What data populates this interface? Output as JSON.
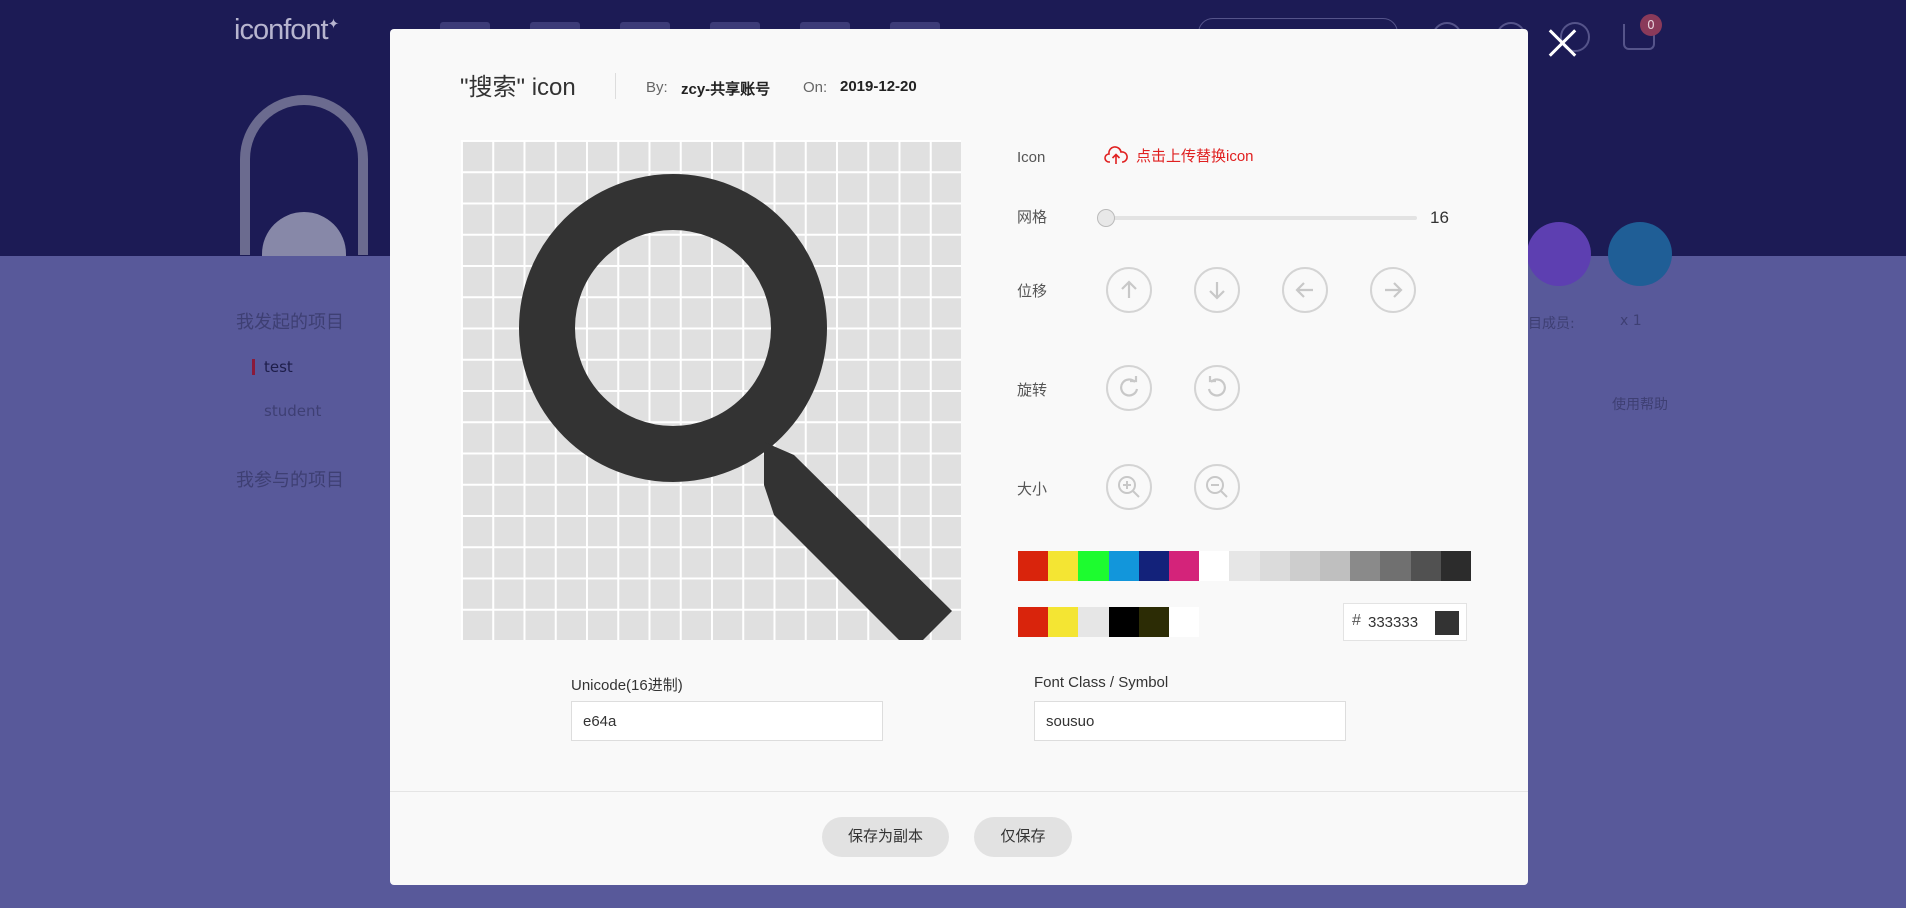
{
  "background": {
    "logo": "iconfont",
    "cart_count": "0",
    "sidebar": {
      "my_projects": "我发起的项目",
      "items": [
        "test",
        "student"
      ],
      "joined_projects": "我参与的项目"
    },
    "members_label": "目成员:",
    "members_count": "x 1",
    "help": "使用帮助"
  },
  "modal": {
    "title": "\"搜索\" icon",
    "by_label": "By:",
    "author": "zcy-共享账号",
    "on_label": "On:",
    "date": "2019-12-20",
    "icon_label": "Icon",
    "upload_label": "点击上传替换icon",
    "grid_label": "网格",
    "grid_value": "16",
    "grid_fraction": 0,
    "shift_label": "位移",
    "rotate_label": "旋转",
    "size_label": "大小",
    "palette_top": [
      "#d9240c",
      "#f4e533",
      "#1dfc2f",
      "#1296db",
      "#13227a",
      "#d4237a",
      "#ffffff",
      "#e6e6e6",
      "#dbdbdb",
      "#cdcdcd",
      "#bfbfbf",
      "#8a8a8a",
      "#707070",
      "#515151",
      "#2c2c2c"
    ],
    "palette_recent": [
      "#d9240c",
      "#f4e533",
      "#e6e6e6",
      "#000000",
      "#2c2c05",
      "#ffffff"
    ],
    "color_hash": "#",
    "color_value": "333333",
    "icon_color": "#333333",
    "unicode_label": "Unicode(16进制)",
    "unicode_value": "e64a",
    "fontclass_label": "Font Class / Symbol",
    "fontclass_value": "sousuo",
    "save_copy_label": "保存为副本",
    "save_only_label": "仅保存"
  }
}
